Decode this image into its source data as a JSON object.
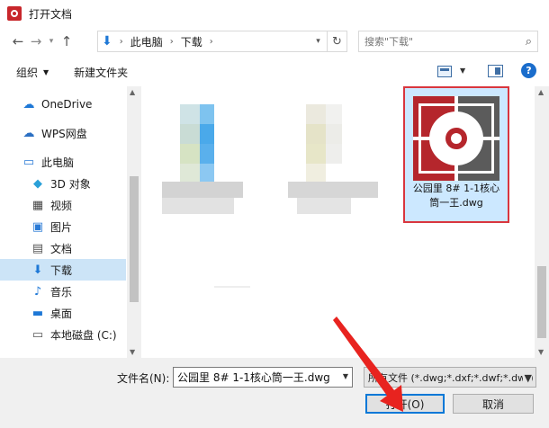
{
  "window": {
    "title": "打开文档"
  },
  "address": {
    "breadcrumbs": [
      "此电脑",
      "下载"
    ],
    "search_placeholder": "搜索\"下载\""
  },
  "toolbar": {
    "organize": "组织",
    "new_folder": "新建文件夹",
    "help": "?"
  },
  "nav": {
    "items": [
      {
        "label": "OneDrive",
        "icon": "cloud-icon"
      },
      {
        "label": "WPS网盘",
        "icon": "cloud-icon"
      },
      {
        "label": "此电脑",
        "icon": "computer-icon"
      },
      {
        "label": "3D 对象",
        "icon": "cube-icon"
      },
      {
        "label": "视频",
        "icon": "film-icon"
      },
      {
        "label": "图片",
        "icon": "picture-icon"
      },
      {
        "label": "文档",
        "icon": "document-icon"
      },
      {
        "label": "下载",
        "icon": "download-icon",
        "selected": true
      },
      {
        "label": "音乐",
        "icon": "music-icon"
      },
      {
        "label": "桌面",
        "icon": "desktop-icon"
      },
      {
        "label": "本地磁盘 (C:)",
        "icon": "drive-icon"
      }
    ]
  },
  "files": [
    {
      "name": "公园里 8# 1-1核心筒一王.dwg",
      "selected": true,
      "icon": "dwg-file-icon"
    }
  ],
  "bottom": {
    "filename_label": "文件名(N):",
    "filename_value": "公园里 8# 1-1核心筒一王.dwg",
    "filetype_value": "所有文件 (*.dwg;*.dxf;*.dwf;*.dwt)",
    "open_label": "打开(O)",
    "cancel_label": "取消"
  },
  "colors": {
    "accent": "#0078d7",
    "highlight": "#d9363e",
    "selected_bg": "#cce4f7"
  }
}
